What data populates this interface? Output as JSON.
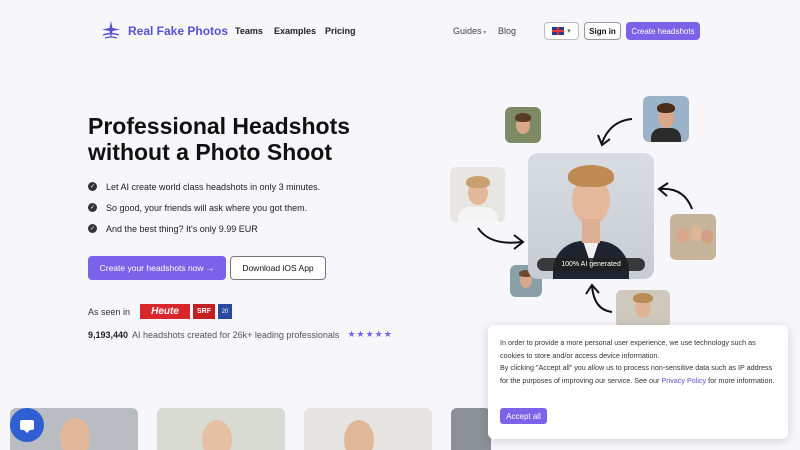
{
  "nav": {
    "logo_text": "Real Fake Photos",
    "links": [
      "Teams",
      "Examples",
      "Pricing"
    ],
    "guides": "Guides",
    "blog": "Blog",
    "sign_in": "Sign in",
    "create": "Create headshots"
  },
  "hero": {
    "title_line1": "Professional Headshots",
    "title_line2": "without a Photo Shoot",
    "bullets": [
      "Let AI create world class headshots in only 3 minutes.",
      "So good, your friends will ask where you got them.",
      "And the best thing? It's only 9.99 EUR"
    ],
    "cta_primary": "Create your headshots now →",
    "cta_secondary": "Download iOS App",
    "as_seen_in": "As seen in",
    "badges": [
      "Heute",
      "SRF",
      "20"
    ],
    "stats_number": "9,193,440",
    "stats_text": "AI headshots created for 26k+ leading professionals",
    "stars": "★★★★★"
  },
  "showcase": {
    "ai_label": "100% AI generated"
  },
  "cookie": {
    "line1": "In order to provide a more personal user experience, we use technology such as cookies to store and/or access device information.",
    "line2_before": "By clicking \"Accept all\" you allow us to process non-sensitive data such as IP address for the purposes of improving our service. See our ",
    "link": "Privacy Policy",
    "line2_after": " for more information.",
    "accept": "Accept all"
  },
  "colors": {
    "accent": "#7a63e8",
    "brand": "#5b4fd6",
    "chat": "#2f5fd0"
  },
  "icons": [
    "logo-star-icon",
    "flag-uk-icon",
    "chevron-down-icon",
    "check-icon",
    "arrow-icon",
    "chat-icon"
  ]
}
